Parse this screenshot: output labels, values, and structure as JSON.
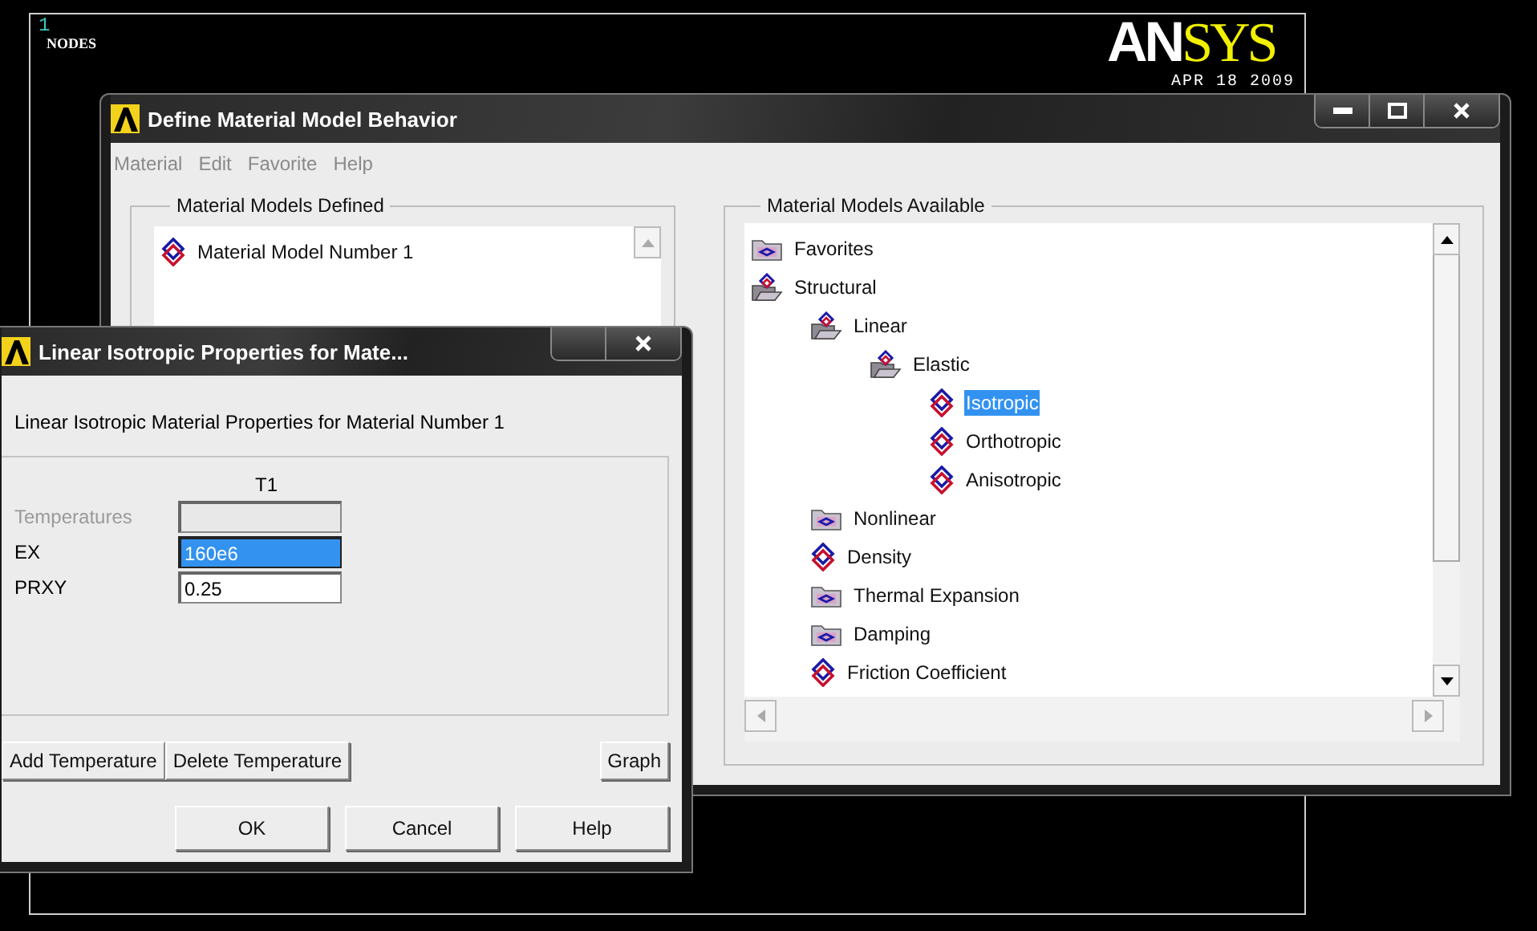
{
  "graphics": {
    "number": "1",
    "label": "NODES",
    "logo": {
      "lead": "AN",
      "rest": "SYS"
    },
    "date": "APR 18 2009"
  },
  "main_window": {
    "title": "Define Material Model Behavior",
    "menu": [
      "Material",
      "Edit",
      "Favorite",
      "Help"
    ],
    "defined": {
      "title": "Material Models Defined",
      "items": [
        {
          "label": "Material Model Number 1",
          "selected": false
        }
      ]
    },
    "available": {
      "title": "Material Models Available",
      "tree": [
        {
          "label": "Favorites",
          "kind": "folder",
          "selected": false
        },
        {
          "label": "Structural",
          "kind": "open-folder",
          "selected": false,
          "children": [
            {
              "label": "Linear",
              "kind": "open-folder",
              "selected": false,
              "children": [
                {
                  "label": "Elastic",
                  "kind": "open-folder",
                  "selected": false,
                  "children": [
                    {
                      "label": "Isotropic",
                      "kind": "material",
                      "selected": true
                    },
                    {
                      "label": "Orthotropic",
                      "kind": "material",
                      "selected": false
                    },
                    {
                      "label": "Anisotropic",
                      "kind": "material",
                      "selected": false
                    }
                  ]
                }
              ]
            },
            {
              "label": "Nonlinear",
              "kind": "folder",
              "selected": false
            },
            {
              "label": "Density",
              "kind": "material",
              "selected": false
            },
            {
              "label": "Thermal Expansion",
              "kind": "folder",
              "selected": false
            },
            {
              "label": "Damping",
              "kind": "folder",
              "selected": false
            },
            {
              "label": "Friction Coefficient",
              "kind": "material",
              "selected": false
            }
          ]
        }
      ]
    }
  },
  "dialog": {
    "title": "Linear Isotropic Properties for Mate...",
    "heading": "Linear Isotropic Material Properties for Material Number 1",
    "column": "T1",
    "rows": [
      {
        "label": "Temperatures",
        "disabled": true,
        "selected": false
      },
      {
        "label": "EX",
        "value": "160e6",
        "disabled": false,
        "selected": true
      },
      {
        "label": "PRXY",
        "value": "0.25",
        "disabled": false,
        "selected": false
      }
    ],
    "table_buttons": [
      "Add Temperature",
      "Delete Temperature"
    ],
    "graph_button": "Graph",
    "buttons": [
      "OK",
      "Cancel",
      "Help"
    ]
  }
}
